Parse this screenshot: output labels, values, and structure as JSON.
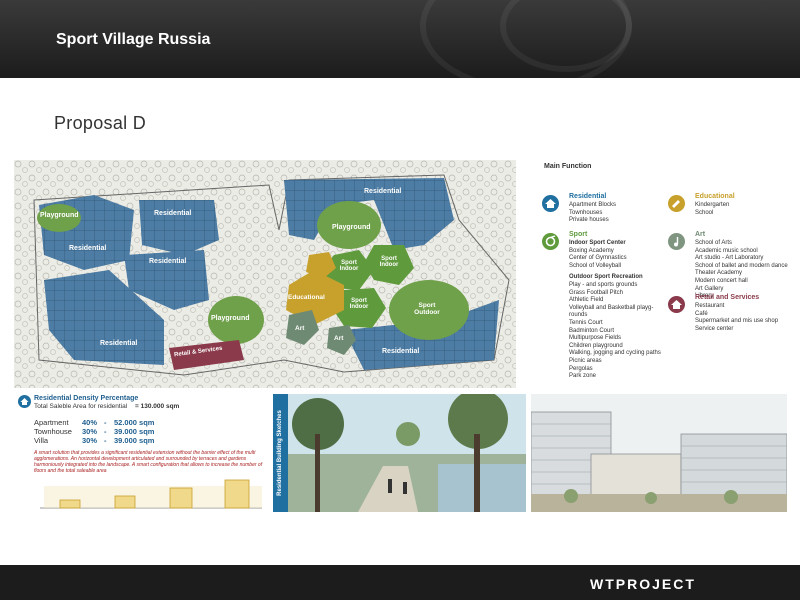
{
  "header": {
    "title": "Sport Village Russia"
  },
  "slide": {
    "subtitle": "Proposal D"
  },
  "map": {
    "zone_labels": {
      "playground_nw": "Playground",
      "residential_n1": "Residential",
      "residential_w": "Residential",
      "residential_c": "Residential",
      "playground_c": "Playground",
      "residential_sw": "Residential",
      "retail": "Retail & Services",
      "residential_ne": "Residential",
      "playground_ne": "Playground",
      "sport_indoor_1": "Sport Indoor",
      "sport_indoor_2": "Sport Indoor",
      "sport_indoor_3": "Sport Indoor",
      "educational": "Educational",
      "sport_outdoor": "Sport Outdoor",
      "art_1": "Art",
      "art_2": "Art",
      "residential_se": "Residential"
    }
  },
  "legend": {
    "title": "Main Function",
    "residential": {
      "title": "Residential",
      "items": [
        "Apartment Blocks",
        "Townhouses",
        "Private houses"
      ]
    },
    "sport": {
      "title": "Sport",
      "indoor_title": "Indoor Sport Center",
      "indoor_items": [
        "Boxing Academy",
        "Center of Gymnastics",
        "School of Volleyball"
      ],
      "outdoor_title": "Outdoor Sport Recreation",
      "outdoor_items": [
        "Play - and sports grounds",
        "Grass Football Pitch",
        "Athletic Field",
        "Volleyball and Basketball playg-",
        "rounds",
        "Tennis Court",
        "Badminton Court",
        "Multipurpose Fields",
        "Children playground",
        "Walking, jogging and cycling paths",
        "Picnic areas",
        "Pergolas",
        "Park zone"
      ]
    },
    "educational": {
      "title": "Educational",
      "items": [
        "Kindergarten",
        "School"
      ]
    },
    "art": {
      "title": "Art",
      "items": [
        "School of Arts",
        "Academic music school",
        "Art studio - Art Laboratory",
        "School of ballet and modern dance",
        "Theater Academy",
        "Modern concert hall",
        "Art Gallery",
        "Library"
      ]
    },
    "retail": {
      "title": "Retail and Services",
      "items": [
        "Restaurant",
        "Café",
        "Supermarket and mis use shop",
        "Service center"
      ]
    }
  },
  "density": {
    "title": "Residential Density Percentage",
    "total_label": "Total Saleble Area for residential",
    "total_value": "= 130.000 sqm",
    "rows": [
      {
        "label": "Apartment",
        "percent": "40%",
        "dash": "-",
        "value": "52.000 sqm"
      },
      {
        "label": "Townhouse",
        "percent": "30%",
        "dash": "-",
        "value": "39.000 sqm"
      },
      {
        "label": "Villa",
        "percent": "30%",
        "dash": "-",
        "value": "39.000 sqm"
      }
    ],
    "note": "A smart solution that provides a significant residential extension without the barrier effect of the multi agglomerations. An horizontal development articulated and surrounded by terraces and gardens harmoniously integrated into the landscape. A smart configuration that allows to increase the number of floors and the total saleable area"
  },
  "sketch": {
    "band_label": "Residential Building Sketches"
  },
  "footer": {
    "logo": "WTPROJECT"
  },
  "colors": {
    "residential": "#3f6f96",
    "sport": "#5f9a3c",
    "educational": "#c8a12c",
    "art": "#6f8a72",
    "retail": "#8a3a4a",
    "accent_blue": "#1f6fa0"
  }
}
